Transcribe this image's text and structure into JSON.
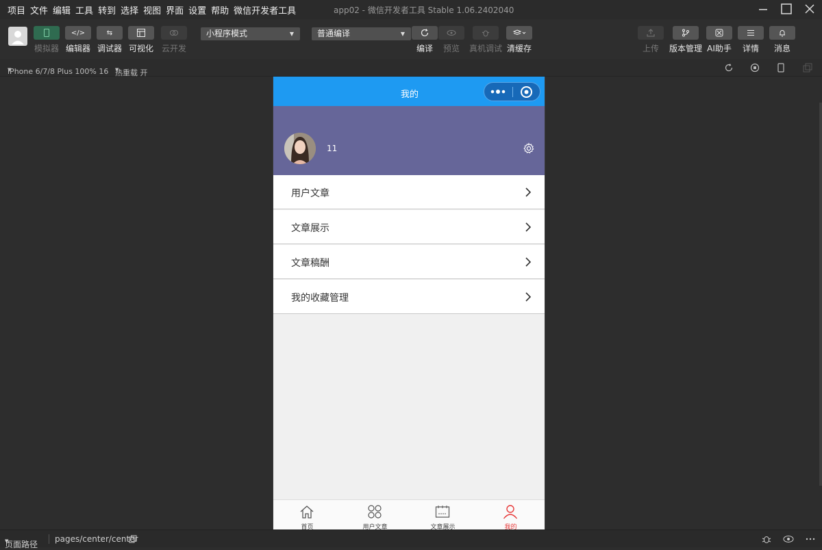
{
  "menubar": {
    "items": [
      "项目",
      "文件",
      "编辑",
      "工具",
      "转到",
      "选择",
      "视图",
      "界面",
      "设置",
      "帮助",
      "微信开发者工具"
    ],
    "window_title": "app02 - 微信开发者工具 Stable 1.06.2402040"
  },
  "toolbar": {
    "left_buttons": [
      {
        "label": "模拟器",
        "icon": "phone-icon",
        "enabled": false,
        "active": true
      },
      {
        "label": "编辑器",
        "icon": "code-icon",
        "enabled": true
      },
      {
        "label": "调试器",
        "icon": "debug-icon",
        "enabled": true
      },
      {
        "label": "可视化",
        "icon": "layout-icon",
        "enabled": true
      },
      {
        "label": "云开发",
        "icon": "cloud-icon",
        "enabled": false
      }
    ],
    "mode_select": "小程序模式",
    "compile_select": "普通编译",
    "actions": [
      {
        "label": "编译",
        "icon": "refresh-icon",
        "enabled": true
      },
      {
        "label": "预览",
        "icon": "eye-icon",
        "enabled": false
      },
      {
        "label": "真机调试",
        "icon": "bug-icon",
        "enabled": false
      },
      {
        "label": "清缓存",
        "icon": "layers-icon",
        "enabled": true
      }
    ],
    "right_buttons": [
      {
        "label": "上传",
        "icon": "upload-icon",
        "enabled": false
      },
      {
        "label": "版本管理",
        "icon": "branch-icon",
        "enabled": true
      },
      {
        "label": "AI助手",
        "icon": "ai-icon",
        "enabled": true
      },
      {
        "label": "详情",
        "icon": "menu-icon",
        "enabled": true
      },
      {
        "label": "消息",
        "icon": "bell-icon",
        "enabled": true
      }
    ]
  },
  "subbar": {
    "device": "iPhone 6/7/8 Plus 100% 16",
    "hot_reload": "热重载 开"
  },
  "phone": {
    "nav_title": "我的",
    "username": "11",
    "menu": [
      "用户文章",
      "文章展示",
      "文章稿酬",
      "我的收藏管理"
    ],
    "tabs": [
      {
        "label": "首页",
        "icon": "home-icon",
        "active": false
      },
      {
        "label": "用户文章",
        "icon": "grid-icon",
        "active": false
      },
      {
        "label": "文章展示",
        "icon": "board-icon",
        "active": false
      },
      {
        "label": "我的",
        "icon": "user-icon",
        "active": true
      }
    ]
  },
  "statusbar": {
    "page_path_label": "页面路径",
    "page_path": "pages/center/center"
  },
  "colors": {
    "nav_blue": "#1e9af2",
    "profile_purple": "#666699",
    "active_tab": "#e73939",
    "simulator_green": "#2f6b50"
  }
}
